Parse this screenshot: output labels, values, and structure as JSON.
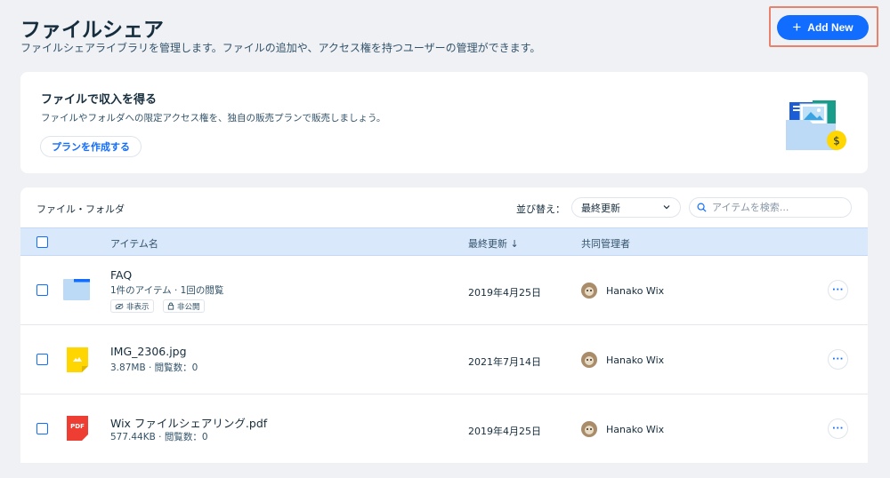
{
  "header": {
    "title": "ファイルシェア",
    "subtitle": "ファイルシェアライブラリを管理します。ファイルの追加や、アクセス権を持つユーザーの管理ができます。",
    "add_new_label": "Add New"
  },
  "promo": {
    "title": "ファイルで収入を得る",
    "description": "ファイルやフォルダへの限定アクセス権を、独自の販売プランで販売しましょう。",
    "button_label": "プランを作成する"
  },
  "table": {
    "title": "ファイル・フォルダ",
    "sort_label": "並び替え：",
    "sort_value": "最終更新",
    "search_placeholder": "アイテムを検索...",
    "columns": {
      "name": "アイテム名",
      "updated": "最終更新 ↓",
      "owner": "共同管理者"
    },
    "rows": [
      {
        "name": "FAQ",
        "meta": "1件のアイテム · 1回の閲覧",
        "date": "2019年4月25日",
        "owner": "Hanako Wix",
        "type_icon": "folder-icon",
        "tags": [
          "非表示",
          "非公開"
        ]
      },
      {
        "name": "IMG_2306.jpg",
        "meta": "3.87MB · 閲覧数：0",
        "date": "2021年7月14日",
        "owner": "Hanako Wix",
        "type_icon": "image-file-icon"
      },
      {
        "name": "Wix ファイルシェアリング.pdf",
        "meta": "577.44KB · 閲覧数：0",
        "date": "2019年4月25日",
        "owner": "Hanako Wix",
        "type_icon": "pdf-file-icon",
        "pdf_badge": "PDF"
      }
    ],
    "more_label": "···"
  },
  "colors": {
    "accent": "#116dff",
    "page_bg": "#f0f1f5",
    "header_row_bg": "#dae8fc",
    "highlight_frame": "#e8826c",
    "folder": "#bcd9f5",
    "image_file": "#ffd600",
    "pdf_file": "#ee3e34"
  }
}
